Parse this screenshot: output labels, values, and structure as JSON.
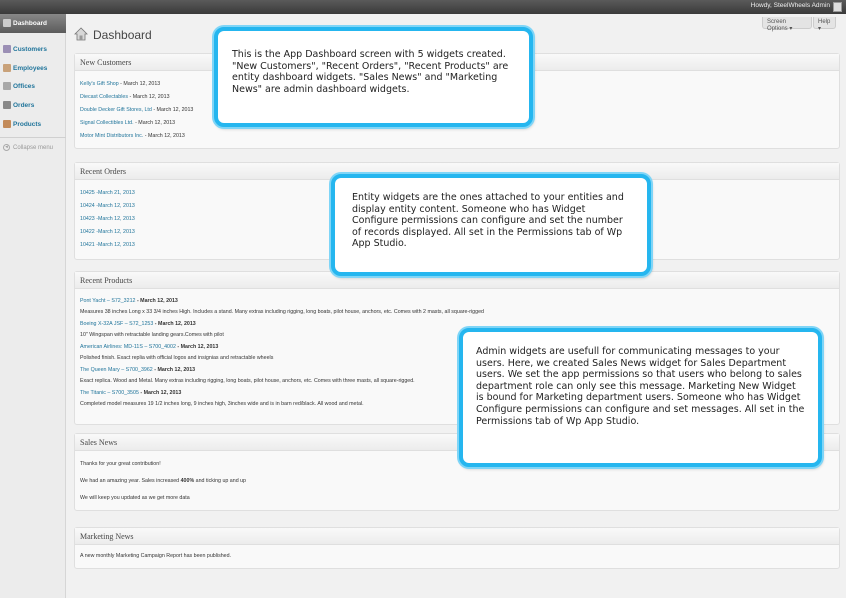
{
  "adminbar": {
    "howdy": "Howdy, SteelWheels Admin"
  },
  "sidebar": {
    "items": [
      {
        "label": "Dashboard",
        "icon": "dashboard-icon",
        "active": true
      },
      {
        "label": "Customers",
        "icon": "customers-icon"
      },
      {
        "label": "Employees",
        "icon": "employees-icon"
      },
      {
        "label": "Offices",
        "icon": "offices-icon"
      },
      {
        "label": "Orders",
        "icon": "orders-icon"
      },
      {
        "label": "Products",
        "icon": "products-icon"
      }
    ],
    "collapse": "Collapse menu"
  },
  "header": {
    "title": "Dashboard",
    "screen_options": "Screen Options ▾",
    "help": "Help ▾"
  },
  "widgets": {
    "new_customers": {
      "title": "New Customers",
      "items": [
        {
          "name": "Kelly's Gift Shop",
          "date": " - March 12, 2013"
        },
        {
          "name": "Diecast Collectables",
          "date": " - March 12, 2013"
        },
        {
          "name": "Double Decker Gift Stores, Ltd",
          "date": " - March 12, 2013"
        },
        {
          "name": "Signal Collectibles Ltd.",
          "date": " - March 12, 2013"
        },
        {
          "name": "Motor Mint Distributors Inc.",
          "date": " - March 12, 2013"
        }
      ]
    },
    "recent_orders": {
      "title": "Recent Orders",
      "items": [
        {
          "name": "10425",
          "date": " -March 21, 2013"
        },
        {
          "name": "10424",
          "date": " -March 12, 2013"
        },
        {
          "name": "10423",
          "date": " -March 12, 2013"
        },
        {
          "name": "10422",
          "date": " -March 12, 2013"
        },
        {
          "name": "10421",
          "date": " -March 12, 2013"
        }
      ]
    },
    "recent_products": {
      "title": "Recent Products",
      "items": [
        {
          "name": "Pont Yacht – S72_3212",
          "date": " - March 12, 2013",
          "desc": "Measures 38 inches Long x 33 3/4 inches High. Includes a stand. Many extras including rigging, long boats, pilot house, anchors, etc. Comes with 2 masts, all square-rigged"
        },
        {
          "name": "Boeing X-32A JSF – S72_1253",
          "date": " - March 12, 2013",
          "desc": "10\" Wingspan with retractable landing gears.Comes with pilot"
        },
        {
          "name": "American Airlines: MD-11S – S700_4002",
          "date": " - March 12, 2013",
          "desc": "Polished finish. Exact replia with official logos and insignias and retractable wheels"
        },
        {
          "name": "The Queen Mary – S700_3962",
          "date": " - March 12, 2013",
          "desc": "Exact replica. Wood and Metal. Many extras including rigging, long boats, pilot house, anchors, etc. Comes with three masts, all square-rigged."
        },
        {
          "name": "The Titanic – S700_3505",
          "date": " - March 12, 2013",
          "desc": "Completed model measures 19 1/2 inches long, 9 inches high, 3inches wide and is in barn red/black. All wood and metal."
        }
      ]
    },
    "sales_news": {
      "title": "Sales News",
      "line1": "Thanks for your great contribution!",
      "line2_pre": "We had an amazing year. Sales increased ",
      "line2_bold": "400%",
      "line2_post": " and ticking up and up",
      "line3": "We will keep you updated as we get more data"
    },
    "marketing_news": {
      "title": "Marketing News",
      "line1": "A new monthly Marketing Campaign Report has been published."
    }
  },
  "callouts": {
    "one": "This is the App Dashboard screen with 5 widgets created. \"New Customers\", \"Recent Orders\", \"Recent Products\" are  entity dashboard widgets. \"Sales News\" and \"Marketing News\" are admin dashboard widgets.",
    "two": "Entity widgets are the ones attached to your entities and display entity content. Someone who has Widget Configure permissions can configure and set the number of records displayed. All set in the Permissions tab of Wp App Studio.",
    "three": "Admin widgets are usefull for communicating messages to your users. Here, we created Sales News widget for Sales Department users. We set the app permissions so that users who belong to sales department role can only see this message. Marketing New Widget is bound for Marketing department users. Someone who has Widget Configure permissions can configure and set messages. All set in the Permissions tab of Wp App Studio."
  },
  "colors": {
    "accent": "#25b6ef",
    "link": "#21759b",
    "adminbar": "#464646"
  }
}
